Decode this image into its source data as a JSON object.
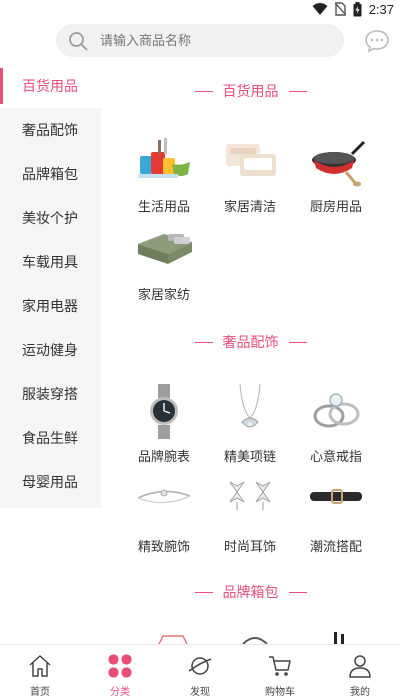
{
  "status_bar": {
    "time": "2:37"
  },
  "search": {
    "placeholder": "请输入商品名称"
  },
  "colors": {
    "accent": "#e94e77",
    "sidebar_bg": "#f5f5f5"
  },
  "sidebar": {
    "items": [
      {
        "label": "百货用品",
        "active": true
      },
      {
        "label": "奢品配饰"
      },
      {
        "label": "品牌箱包"
      },
      {
        "label": "美妆个护"
      },
      {
        "label": "车载用具"
      },
      {
        "label": "家用电器"
      },
      {
        "label": "运动健身"
      },
      {
        "label": "服装穿搭"
      },
      {
        "label": "食品生鲜"
      },
      {
        "label": "母婴用品"
      }
    ]
  },
  "sections": [
    {
      "title": "百货用品",
      "products": [
        {
          "label": "生活用品",
          "icon": "cups-bowls-icon"
        },
        {
          "label": "家居清洁",
          "icon": "tissue-pack-icon"
        },
        {
          "label": "厨房用品",
          "icon": "cookware-icon"
        },
        {
          "label": "家居家纺",
          "icon": "bedding-icon"
        }
      ]
    },
    {
      "title": "奢品配饰",
      "products": [
        {
          "label": "品牌腕表",
          "icon": "watch-icon"
        },
        {
          "label": "精美项链",
          "icon": "necklace-icon"
        },
        {
          "label": "心意戒指",
          "icon": "rings-icon"
        },
        {
          "label": "精致腕饰",
          "icon": "bracelet-icon"
        },
        {
          "label": "时尚耳饰",
          "icon": "earrings-icon"
        },
        {
          "label": "潮流搭配",
          "icon": "belt-icon"
        }
      ]
    },
    {
      "title": "品牌箱包",
      "products": []
    }
  ],
  "bottom_nav": [
    {
      "label": "首页",
      "icon": "home-icon"
    },
    {
      "label": "分类",
      "icon": "category-icon",
      "active": true
    },
    {
      "label": "发现",
      "icon": "planet-icon"
    },
    {
      "label": "购物车",
      "icon": "cart-icon"
    },
    {
      "label": "我的",
      "icon": "user-icon"
    }
  ]
}
